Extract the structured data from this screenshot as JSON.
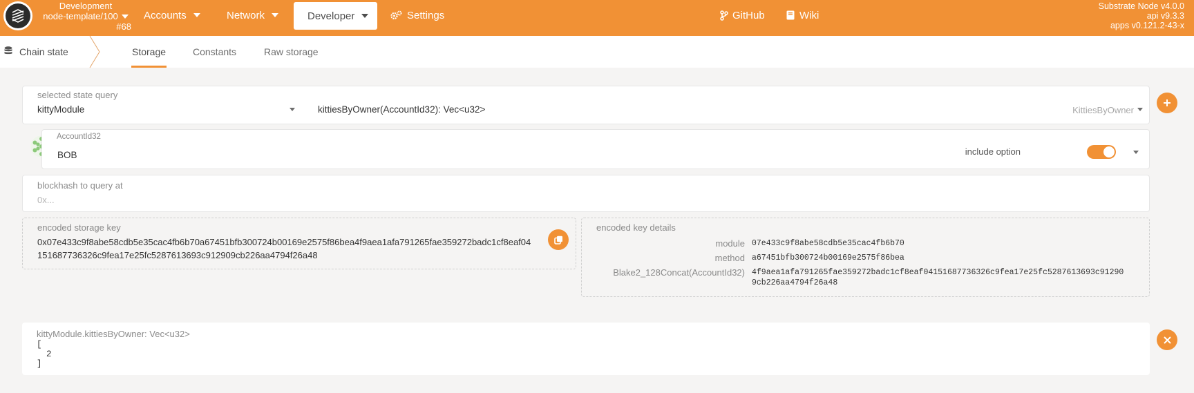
{
  "nav": {
    "chain_name": "Development",
    "runtime": "node-template/100",
    "block": "#68",
    "items": [
      {
        "label": "Accounts"
      },
      {
        "label": "Network"
      },
      {
        "label": "Developer"
      },
      {
        "label": "Settings"
      }
    ],
    "links": [
      {
        "label": "GitHub"
      },
      {
        "label": "Wiki"
      }
    ],
    "node": {
      "name": "Substrate Node v4.0.0",
      "api": "api v9.3.3",
      "apps": "apps v0.121.2-43-x"
    }
  },
  "subnav": {
    "section": "Chain state",
    "tabs": [
      {
        "label": "Storage"
      },
      {
        "label": "Constants"
      },
      {
        "label": "Raw storage"
      }
    ]
  },
  "query": {
    "label": "selected state query",
    "module": "kittyModule",
    "method_signature": "kittiesByOwner(AccountId32): Vec<u32>",
    "method_name": "KittiesByOwner"
  },
  "account": {
    "label": "AccountId32",
    "value": "BOB",
    "include_option_label": "include option",
    "include_option": true
  },
  "blockhash": {
    "label": "blockhash to query at",
    "placeholder": "0x..."
  },
  "storage_key": {
    "label": "encoded storage key",
    "line1": "0x07e433c9f8abe58cdb5e35cac4fb6b70a67451bfb300724b00169e2575f86bea4f9aea1afa791265fae359272badc1cf8eaf04",
    "line2": "151687736326c9fea17e25fc5287613693c912909cb226aa4794f26a48"
  },
  "key_details": {
    "label": "encoded key details",
    "module_label": "module",
    "module_value": "07e433c9f8abe58cdb5e35cac4fb6b70",
    "method_label": "method",
    "method_value": "a67451bfb300724b00169e2575f86bea",
    "hasher_label": "Blake2_128Concat(AccountId32)",
    "hasher_value_1": "4f9aea1afa791265fae359272badc1cf8eaf04151687736326c9fea17e25fc5287613693c91290",
    "hasher_value_2": "9cb226aa4794f26a48"
  },
  "result": {
    "label": "kittyModule.kittiesByOwner: Vec<u32>",
    "open": "[",
    "item": "2",
    "close": "]"
  },
  "colors": {
    "accent": "#f19135",
    "background": "#f5f4f3"
  }
}
